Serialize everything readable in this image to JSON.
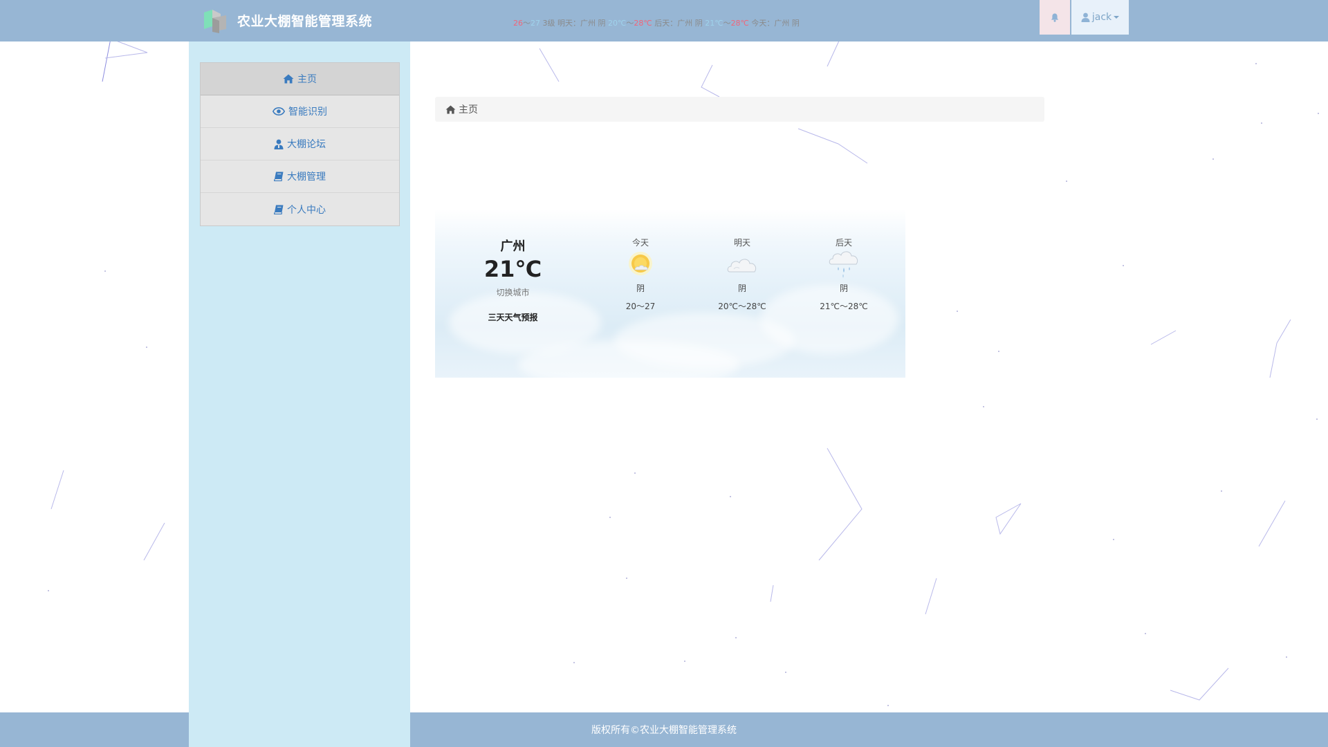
{
  "header": {
    "title": "农业大棚智能管理系统",
    "ticker": [
      {
        "text": "26",
        "tone": "hot"
      },
      {
        "text": "～",
        "tone": "plain"
      },
      {
        "text": "27",
        "tone": "cool"
      },
      {
        "text": " 3级 明天：广州 阴 ",
        "tone": "plain"
      },
      {
        "text": "20℃",
        "tone": "cool"
      },
      {
        "text": "～",
        "tone": "plain"
      },
      {
        "text": "28℃",
        "tone": "hot"
      },
      {
        "text": " 后天：广州 阴 ",
        "tone": "plain"
      },
      {
        "text": "21℃",
        "tone": "cool"
      },
      {
        "text": "～",
        "tone": "plain"
      },
      {
        "text": "28℃",
        "tone": "hot"
      },
      {
        "text": " 今天：广州 阴",
        "tone": "plain"
      }
    ],
    "bell_icon": "bell-icon",
    "user_icon": "user-icon",
    "username": "jack"
  },
  "sidebar": {
    "items": [
      {
        "label": "主页",
        "icon": "home-icon",
        "active": true
      },
      {
        "label": "智能识别",
        "icon": "eye-icon",
        "active": false
      },
      {
        "label": "大棚论坛",
        "icon": "user-tie-icon",
        "active": false
      },
      {
        "label": "大棚管理",
        "icon": "book-icon",
        "active": false
      },
      {
        "label": "个人中心",
        "icon": "book-icon",
        "active": false
      }
    ]
  },
  "breadcrumb": {
    "icon": "home-icon",
    "label": "主页"
  },
  "weather": {
    "city": "广州",
    "temp": "21℃",
    "switch_label": "切换城市",
    "forecast_label": "三天天气预报",
    "days": [
      {
        "label": "今天",
        "icon": "sun-cloud-icon",
        "cond": "阴",
        "range": "20～27"
      },
      {
        "label": "明天",
        "icon": "cloud-icon",
        "cond": "阴",
        "range": "20℃～28℃"
      },
      {
        "label": "后天",
        "icon": "rain-icon",
        "cond": "阴",
        "range": "21℃～28℃"
      }
    ]
  },
  "footer": {
    "copyright": "版权所有©农业大棚智能管理系统"
  },
  "colors": {
    "topbar": "#97b6d4",
    "sidebar": "#cdeaf5",
    "menu_text": "#3a7bbf",
    "ticker_hot": "#f0667a",
    "ticker_cool": "#9fd3ec"
  }
}
